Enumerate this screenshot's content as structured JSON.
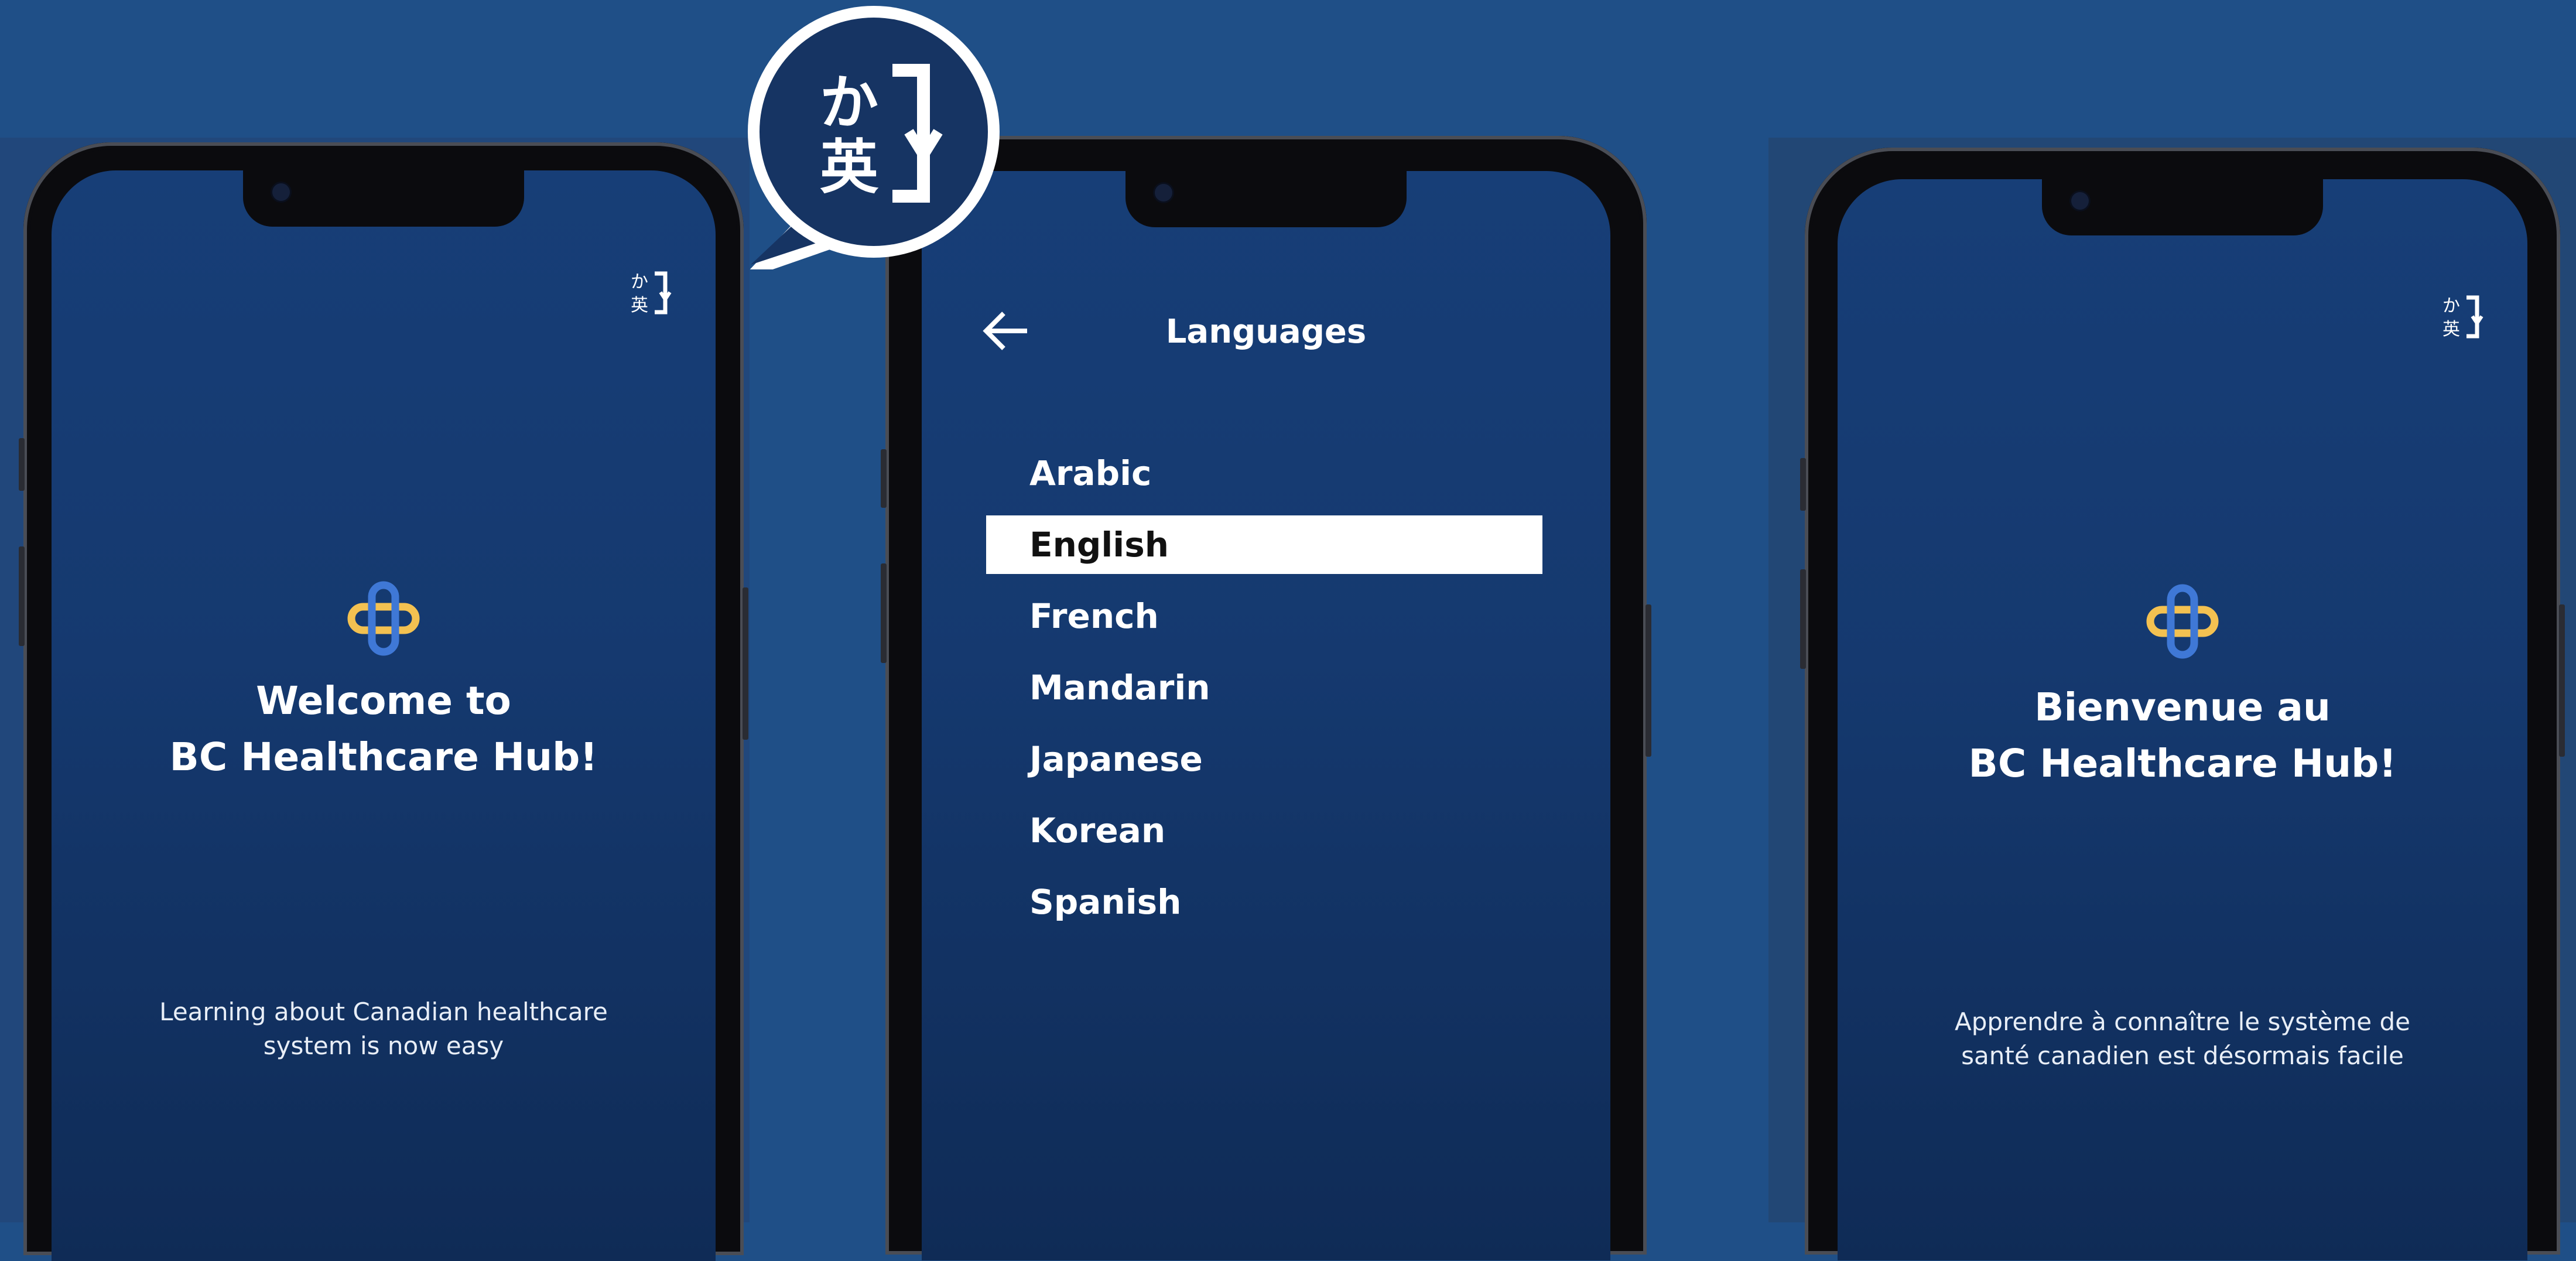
{
  "screens": {
    "welcome_en": {
      "title_line1": "Welcome to",
      "title_line2": "BC Healthcare Hub!",
      "subtitle_line1": "Learning about Canadian healthcare",
      "subtitle_line2": "system is now easy",
      "language_toggle_icon": "translate-icon"
    },
    "languages": {
      "title": "Languages",
      "back_icon": "back-arrow-icon",
      "items": [
        "Arabic",
        "English",
        "French",
        "Mandarin",
        "Japanese",
        "Korean",
        "Spanish"
      ],
      "selected": "English"
    },
    "welcome_fr": {
      "title_line1": "Bienvenue au",
      "title_line2": "BC Healthcare Hub!",
      "subtitle_line1": "Apprendre à connaître le système de",
      "subtitle_line2": "santé canadien est désormais facile",
      "language_toggle_icon": "translate-icon"
    }
  },
  "callout": {
    "glyph_top": "か",
    "glyph_bottom": "英"
  },
  "colors": {
    "background": "#1f4f87",
    "screen_gradient_top": "#173e77",
    "screen_gradient_bottom": "#0f2b56",
    "logo_yellow": "#f3c151",
    "logo_blue": "#3f78d6",
    "callout_fill": "#163463",
    "callout_ring": "#ffffff"
  }
}
